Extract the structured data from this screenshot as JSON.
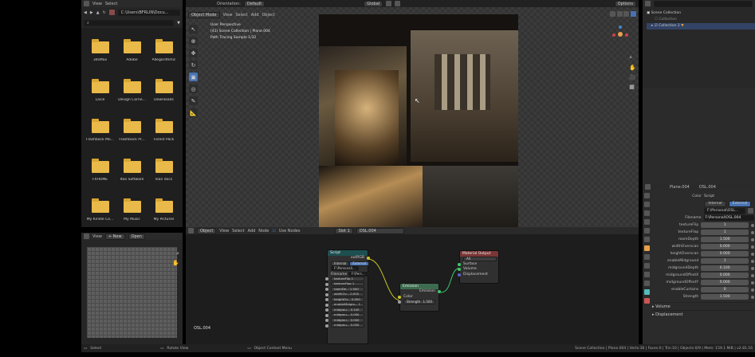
{
  "fb_header": {
    "menu": [
      "View",
      "Select"
    ],
    "path": "C:\\Users\\BFRLIN\\Docu...",
    "search_placeholder": ""
  },
  "folders": [
    {
      "label": "3dsMax"
    },
    {
      "label": "Adobe"
    },
    {
      "label": "Allegorithmic"
    },
    {
      "label": "Lacie"
    },
    {
      "label": "Design Corne..."
    },
    {
      "label": "Downloads"
    },
    {
      "label": "Flashback Mo..."
    },
    {
      "label": "Flashback Pr..."
    },
    {
      "label": "Forest Pack"
    },
    {
      "label": "FXHOME"
    },
    {
      "label": "Itoo Software"
    },
    {
      "label": "lean docs"
    },
    {
      "label": "My Kindle Co..."
    },
    {
      "label": "My Music"
    },
    {
      "label": "My Pictures"
    }
  ],
  "image_editor": {
    "view": "View",
    "new": "+ New",
    "open": "Open"
  },
  "viewport_header": {
    "orientation_label": "Orientation:",
    "orientation_value": "Default",
    "mode": "Object Mode",
    "menus": [
      "View",
      "Select",
      "Add",
      "Object"
    ],
    "transform": "Global",
    "options": "Options"
  },
  "viewport_info": {
    "line1": "User Perspective",
    "line2": "(41) Scene Collection | Plane.004",
    "line3": "Path Tracing Sample 1/32"
  },
  "outliner": {
    "items": [
      "Scene Collection",
      "Collection",
      "Collection 2"
    ]
  },
  "node_header": {
    "type": "Object",
    "menus": [
      "View",
      "Select",
      "Add",
      "Node"
    ],
    "use_nodes": "Use Nodes",
    "slot": "Slot 1",
    "material": "OSL.004"
  },
  "node_editor_label": "OSL.004",
  "nodes": {
    "script": {
      "title": "Script",
      "output": "outRGB",
      "mode_internal": "Internal",
      "mode_external": "External",
      "path": "F:\\Personal\\...",
      "filename_label": "Filename",
      "filename_value": "F:\\Pers...",
      "rows": [
        "textureFlip 1",
        "textureFlop 1",
        "roomDe... 1.500",
        "widthOv... 0.000",
        "heightOv... 0.000",
        "enableMidgro... 1",
        "midgrou... 0.100",
        "midgrou... 0.000",
        "midgrou... 0.000",
        "midgrou... 0.000"
      ]
    },
    "emission": {
      "title": "Emission",
      "output": "Emission",
      "color": "Color",
      "strength": "Strength",
      "strength_value": "1.500"
    },
    "material_output": {
      "title": "Material Output",
      "target": "All",
      "inputs": [
        "Surface",
        "Volume",
        "Displacement"
      ]
    }
  },
  "props_header": {
    "object": "Plane.004",
    "material": "OSL.004"
  },
  "props": {
    "color_label": "Color",
    "color_value": "Script",
    "mode_internal": "Internal",
    "mode_external": "External",
    "path": "F:\\Personal\\OSL...",
    "filename_label": "Filename",
    "filename_value": "F:\\Personal\\OSL.004",
    "rows": [
      {
        "label": "textureFlip",
        "value": "1"
      },
      {
        "label": "textureFlop",
        "value": "1"
      },
      {
        "label": "roomDepth",
        "value": "1.500"
      },
      {
        "label": "widthOverscan",
        "value": "0.000"
      },
      {
        "label": "heightOverscan",
        "value": "0.000"
      },
      {
        "label": "enableMidground",
        "value": "1"
      },
      {
        "label": "midgroundDepth",
        "value": "0.100"
      },
      {
        "label": "midgroundOffsetX",
        "value": "0.000"
      },
      {
        "label": "midgroundOffsetY",
        "value": "0.000"
      },
      {
        "label": "enableCurtains",
        "value": "0"
      },
      {
        "label": "Strength",
        "value": "1.500"
      }
    ],
    "panels": [
      "Volume",
      "Displacement"
    ]
  },
  "statusbar": {
    "select": "Select",
    "rotate": "Rotate View",
    "context": "Object Context Menu",
    "info": "Scene Collection | Plane.004 | Verts:36 | Faces:0 | Tris:10 | Objects:0/9 | Mem: 159.1 MiB | v2.81.16"
  },
  "colors": {
    "accent": "#4772b3",
    "folder": "#e9b949",
    "script_header": "#1e4f50",
    "emission_header": "#3d6b4f",
    "output_header": "#7a3535",
    "origin": "#e8a04a"
  }
}
